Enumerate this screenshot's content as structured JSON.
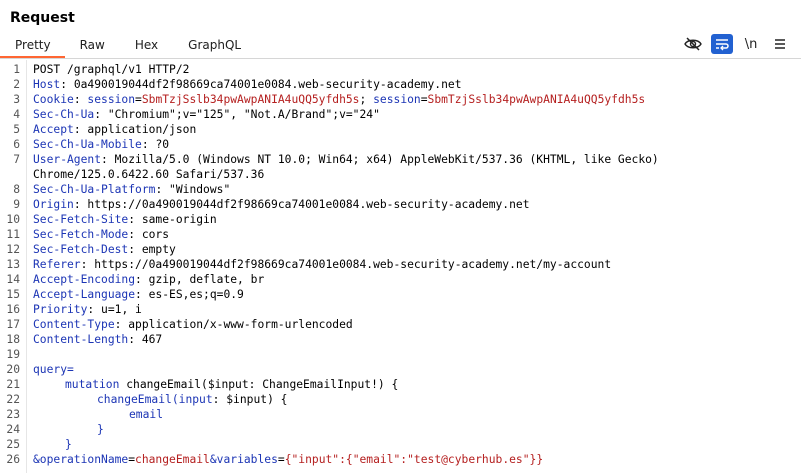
{
  "panel": {
    "title": "Request"
  },
  "tabs": [
    {
      "label": "Pretty"
    },
    {
      "label": "Raw"
    },
    {
      "label": "Hex"
    },
    {
      "label": "GraphQL"
    }
  ],
  "toolbar": {
    "hide_icon": "eye-slash-icon",
    "wrap_icon": "word-wrap-icon",
    "newline_label": "\\n",
    "menu_icon": "hamburger-menu-icon",
    "accent": "#2261d1"
  },
  "request": {
    "l1": "POST /graphql/v1 HTTP/2",
    "l2k": "Host",
    "l2v": " 0a490019044df2f98669ca74001e0084.web-security-academy.net",
    "l3k": "Cookie",
    "l3a": "session",
    "l3b": "SbmTzjSslb34pwAwpANIA4uQQ5yfdh5s",
    "l3c": "session",
    "l3d": "SbmTzjSslb34pwAwpANIA4uQQ5yfdh5s",
    "l4k": "Sec-Ch-Ua",
    "l4v": " \"Chromium\";v=\"125\", \"Not.A/Brand\";v=\"24\"",
    "l5k": "Accept",
    "l5v": " application/json",
    "l6k": "Sec-Ch-Ua-Mobile",
    "l6v": " ?0",
    "l7k": "User-Agent",
    "l7v": " Mozilla/5.0 (Windows NT 10.0; Win64; x64) AppleWebKit/537.36 (KHTML, like Gecko)",
    "l7w": "Chrome/125.0.6422.60 Safari/537.36",
    "l8k": "Sec-Ch-Ua-Platform",
    "l8v": " \"Windows\"",
    "l9k": "Origin",
    "l9v": " https://0a490019044df2f98669ca74001e0084.web-security-academy.net",
    "l10k": "Sec-Fetch-Site",
    "l10v": " same-origin",
    "l11k": "Sec-Fetch-Mode",
    "l11v": " cors",
    "l12k": "Sec-Fetch-Dest",
    "l12v": " empty",
    "l13k": "Referer",
    "l13v": " https://0a490019044df2f98669ca74001e0084.web-security-academy.net/my-account",
    "l14k": "Accept-Encoding",
    "l14v": " gzip, deflate, br",
    "l15k": "Accept-Language",
    "l15v": " es-ES,es;q=0.9",
    "l16k": "Priority",
    "l16v": " u=1, i",
    "l17k": "Content-Type",
    "l17v": " application/x-www-form-urlencoded",
    "l18k": "Content-Length",
    "l18v": " 467",
    "l20": "query=",
    "l21a": "mutation",
    "l21b": " changeEmail($input: ChangeEmailInput!) {",
    "l22a": "changeEmail",
    "l22b": "(",
    "l22c": "input",
    "l22d": ": $input) {",
    "l23": "email",
    "l24": "}",
    "l25": "}",
    "l26a": "&operationName",
    "l26b": "=",
    "l26c": "changeEmail",
    "l26d": "&variables",
    "l26e": "=",
    "l26f": "{\"input\":{\"email\":\"test@cyberhub.es\"}}"
  },
  "line_numbers": [
    "1",
    "2",
    "3",
    "4",
    "5",
    "6",
    "7",
    "",
    "8",
    "9",
    "10",
    "11",
    "12",
    "13",
    "14",
    "15",
    "16",
    "17",
    "18",
    "19",
    "20",
    "21",
    "22",
    "23",
    "24",
    "25",
    "26"
  ]
}
